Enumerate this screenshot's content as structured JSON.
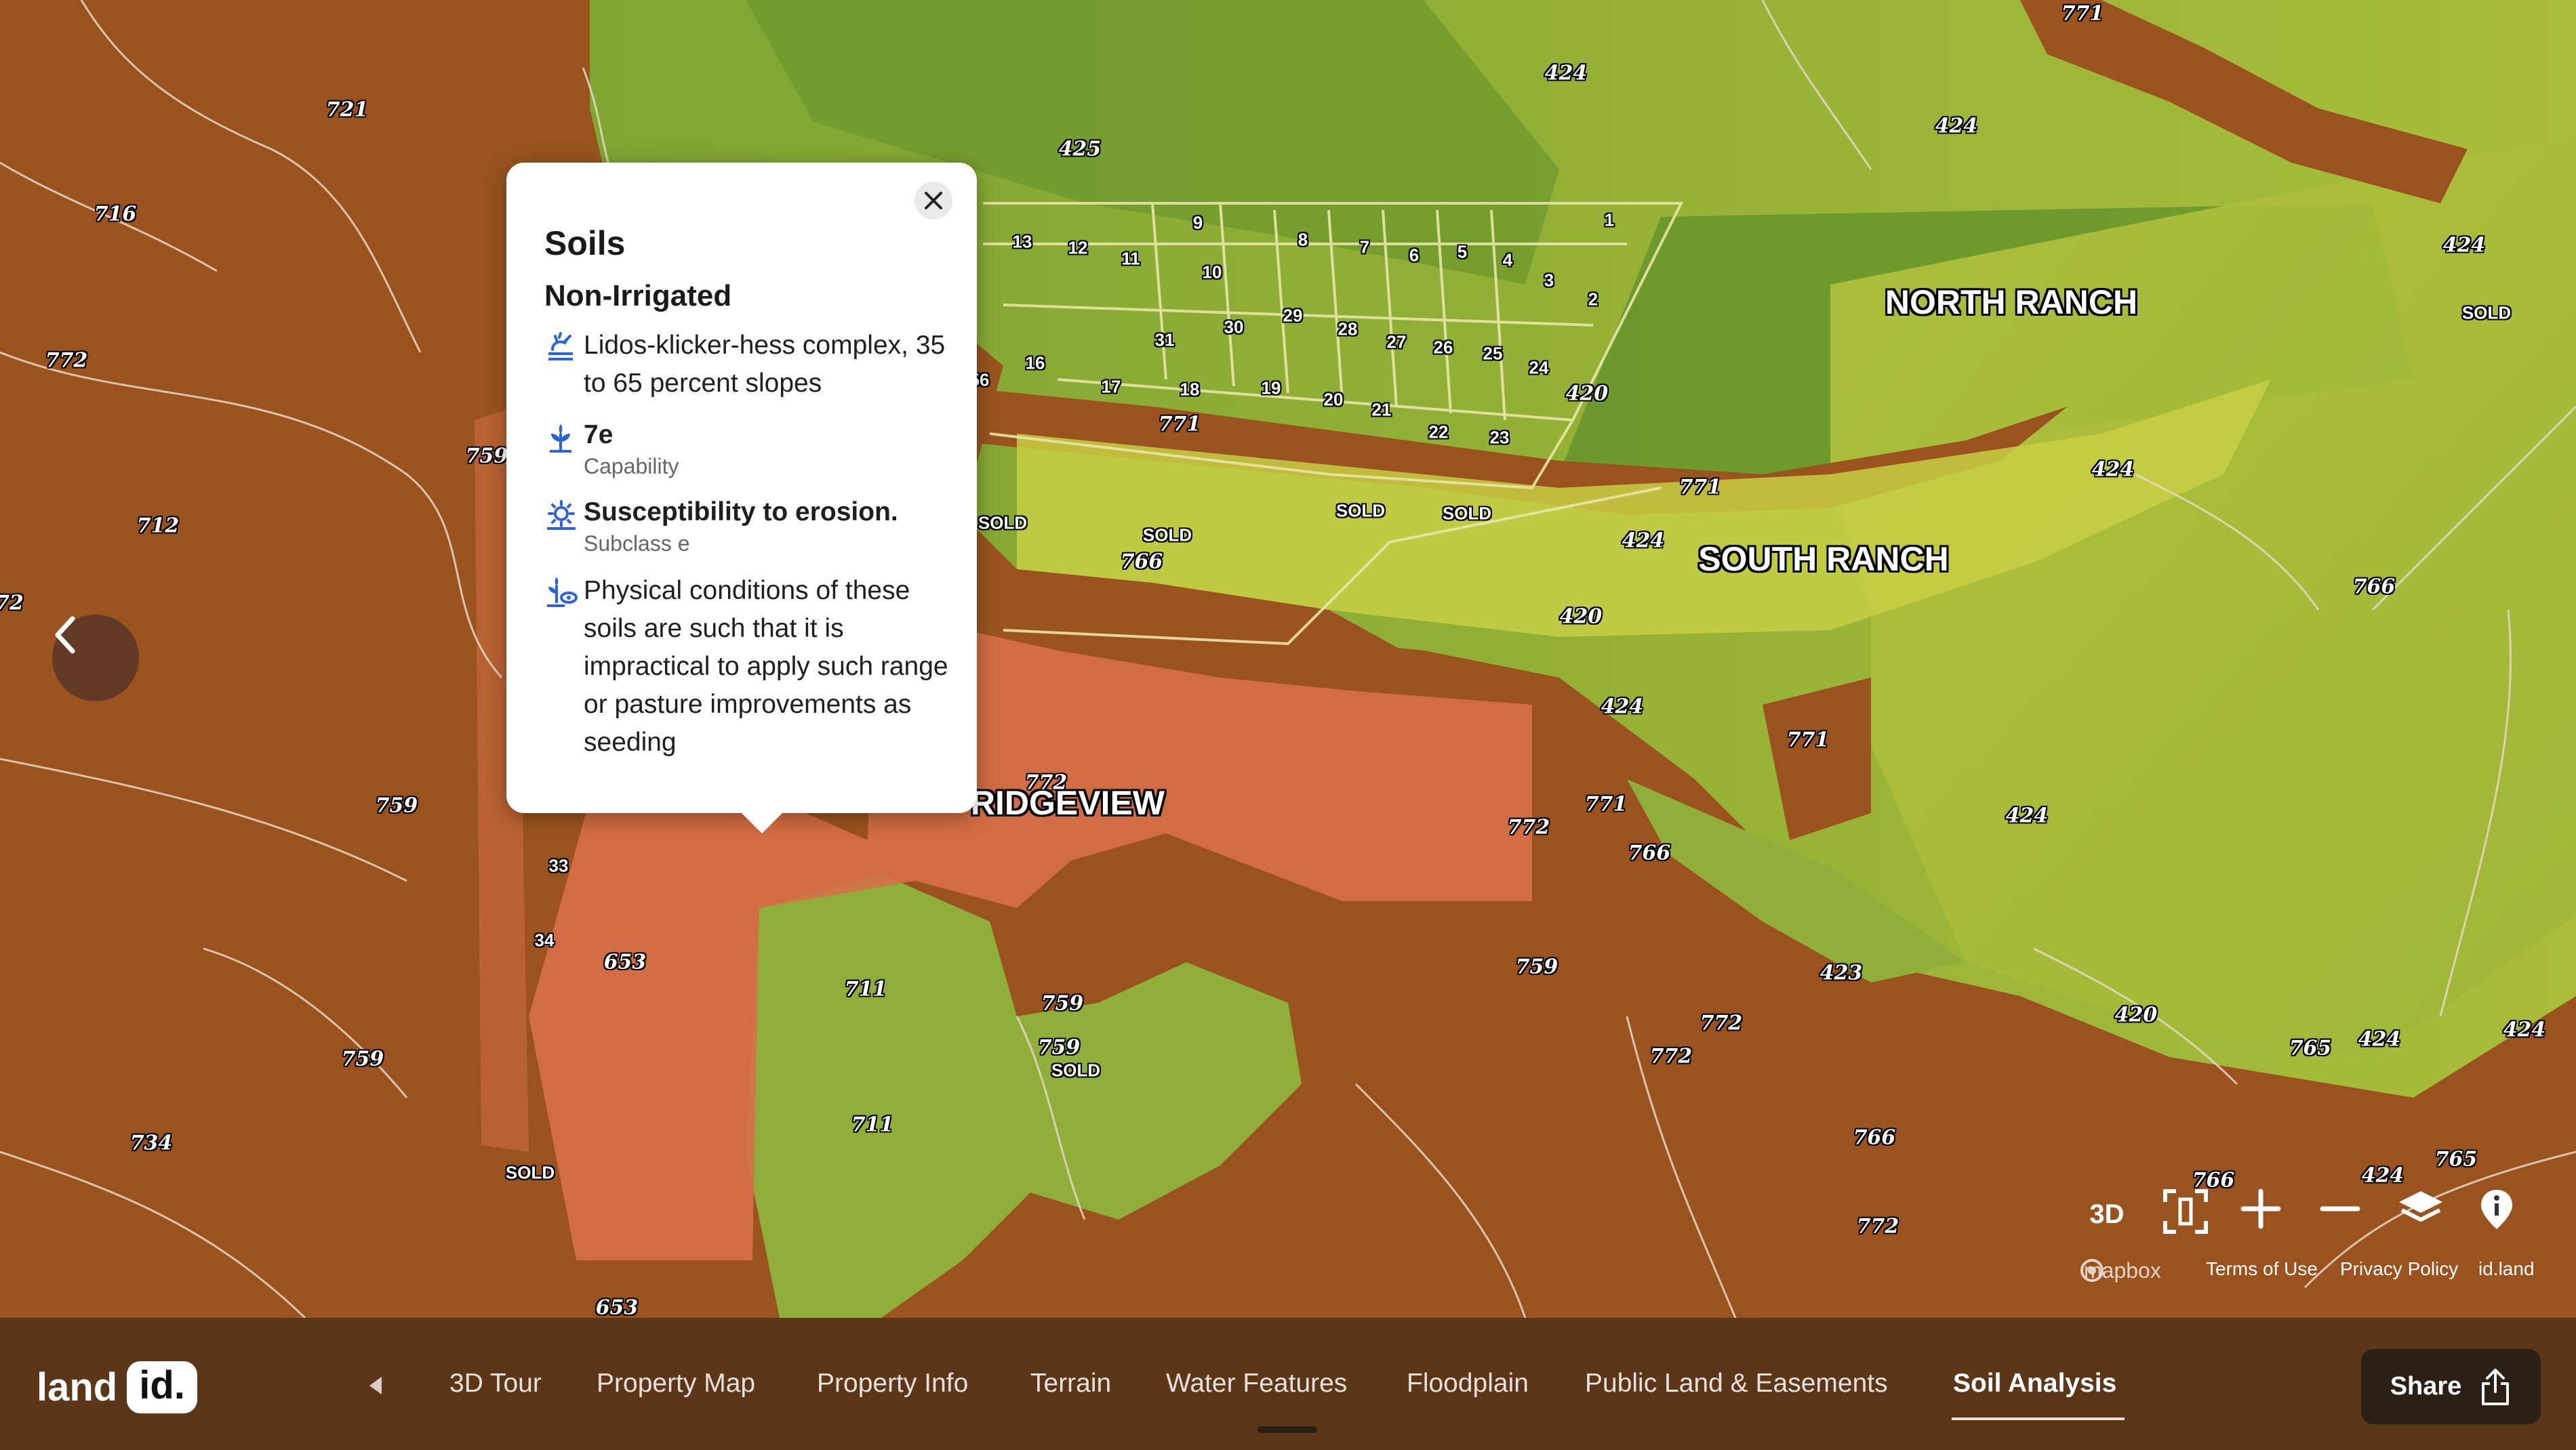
{
  "map": {
    "areas": [
      "NORTH RANCH",
      "SOUTH RANCH",
      "RIDGEVIEW"
    ],
    "soil_labels": [
      "721",
      "716",
      "772",
      "712",
      "72",
      "759",
      "734",
      "653",
      "711",
      "425",
      "424",
      "771",
      "766",
      "420",
      "423",
      "765",
      "SOLD",
      "13",
      "12",
      "11",
      "9",
      "10",
      "8",
      "7",
      "6",
      "5",
      "4",
      "3",
      "2",
      "1",
      "31",
      "30",
      "29",
      "28",
      "27",
      "26",
      "25",
      "24",
      "23",
      "22",
      "21",
      "20",
      "19",
      "18",
      "17",
      "16",
      "33",
      "34",
      "56"
    ],
    "attribution": {
      "mapbox": "mapbox",
      "terms": "Terms of Use",
      "privacy": "Privacy Policy",
      "site": "id.land"
    },
    "controls": {
      "three_d": "3D"
    }
  },
  "popup": {
    "title": "Soils",
    "subtitle": "Non-Irrigated",
    "soil_name": "Lidos-klicker-hess complex, 35 to 65 percent slopes",
    "capability_value": "7e",
    "capability_label": "Capability",
    "erosion_title": "Susceptibility to erosion.",
    "erosion_sub": "Subclass e",
    "description": "Physical conditions of these soils are such that it is impractical to apply such range or pasture improvements as seeding"
  },
  "nav": {
    "logo_text": "land",
    "logo_badge": "id.",
    "tabs": [
      "3D Tour",
      "Property Map",
      "Property Info",
      "Terrain",
      "Water Features",
      "Floodplain",
      "Public Land & Easements",
      "Soil Analysis"
    ],
    "active_tab": "Soil Analysis",
    "share_label": "Share"
  },
  "colors": {
    "soil_brown": "#9a531f",
    "soil_green": "#8fae3a",
    "soil_lime": "#b8c63a",
    "selected_soil": "#d9704a",
    "bar_bg": "#5b3618",
    "popup_icon": "#2d63d8"
  }
}
